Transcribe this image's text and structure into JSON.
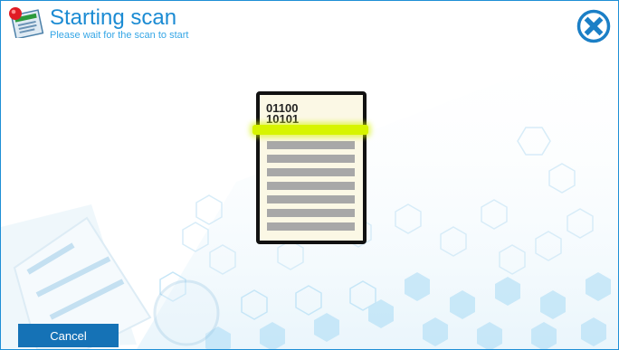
{
  "header": {
    "title": "Starting scan",
    "subtitle": "Please wait for the scan to start",
    "app_icon": "scan-app-icon",
    "close_icon": "close-circle-icon"
  },
  "document": {
    "binary_lines": [
      "01100",
      "10101"
    ],
    "scan_color": "#d7f400"
  },
  "footer": {
    "cancel_label": "Cancel"
  },
  "colors": {
    "accent": "#1b8bd3",
    "button": "#1572b6",
    "border": "#1e8fd6"
  }
}
